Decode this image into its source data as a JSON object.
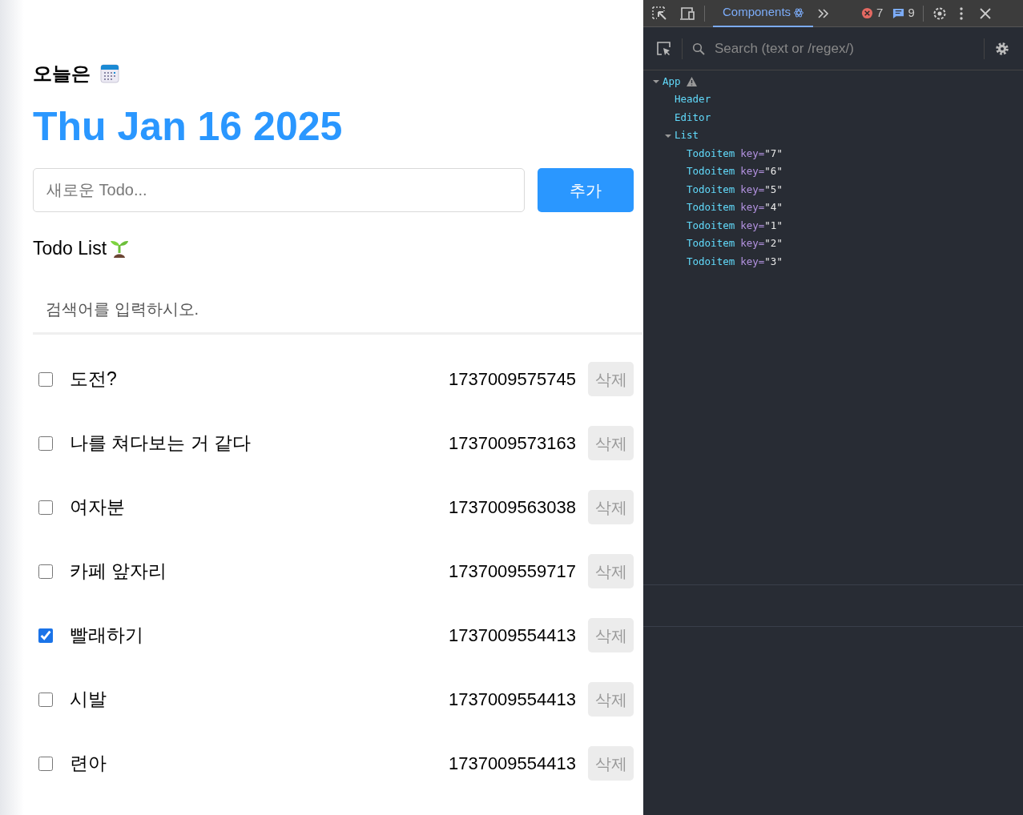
{
  "header": {
    "title": "오늘은",
    "date": "Thu Jan 16 2025"
  },
  "editor": {
    "placeholder": "새로운 Todo...",
    "button": "추가"
  },
  "list": {
    "title": "Todo List",
    "search_placeholder": "검색어를 입력하시오.",
    "todos": [
      {
        "checked": false,
        "content": "도전?",
        "date": "1737009575745",
        "button": "삭제"
      },
      {
        "checked": false,
        "content": "나를 쳐다보는 거 같다",
        "date": "1737009573163",
        "button": "삭제"
      },
      {
        "checked": false,
        "content": "여자분",
        "date": "1737009563038",
        "button": "삭제"
      },
      {
        "checked": false,
        "content": "카페 앞자리",
        "date": "1737009559717",
        "button": "삭제"
      },
      {
        "checked": true,
        "content": "빨래하기",
        "date": "1737009554413",
        "button": "삭제"
      },
      {
        "checked": false,
        "content": "시발",
        "date": "1737009554413",
        "button": "삭제"
      },
      {
        "checked": false,
        "content": "련아",
        "date": "1737009554413",
        "button": "삭제"
      }
    ]
  },
  "devtools": {
    "tabs": [
      {
        "label": "Components",
        "selected": true
      }
    ],
    "error_count": "7",
    "message_count": "9",
    "search_placeholder": "Search (text or /regex/)",
    "tree": [
      {
        "name": "App",
        "expanded": true,
        "warning": true,
        "children": [
          {
            "name": "Header"
          },
          {
            "name": "Editor"
          },
          {
            "name": "List",
            "expanded": true,
            "children": [
              {
                "name": "Todoitem",
                "prop": "key=",
                "value": "\"7\""
              },
              {
                "name": "Todoitem",
                "prop": "key=",
                "value": "\"6\""
              },
              {
                "name": "Todoitem",
                "prop": "key=",
                "value": "\"5\""
              },
              {
                "name": "Todoitem",
                "prop": "key=",
                "value": "\"4\""
              },
              {
                "name": "Todoitem",
                "prop": "key=",
                "value": "\"1\""
              },
              {
                "name": "Todoitem",
                "prop": "key=",
                "value": "\"2\""
              },
              {
                "name": "Todoitem",
                "prop": "key=",
                "value": "\"3\""
              }
            ]
          }
        ]
      }
    ]
  }
}
